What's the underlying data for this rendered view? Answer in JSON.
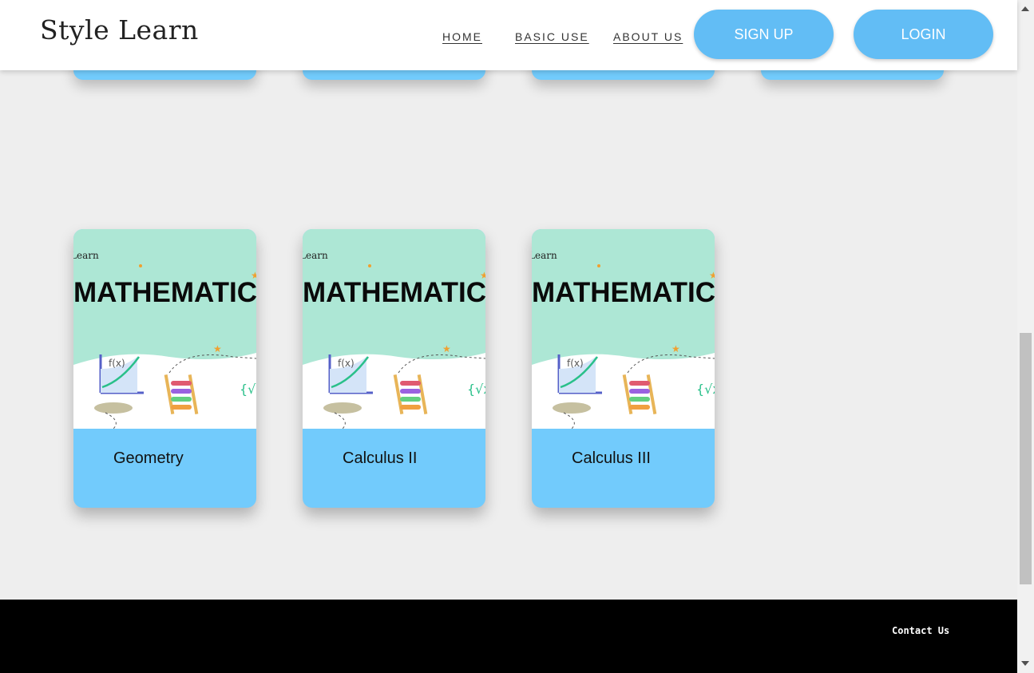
{
  "brand": {
    "logo_text": "Style Learn"
  },
  "nav": {
    "home": "HOME",
    "basic_use": "BASIC USE",
    "about_us": "ABOUT US"
  },
  "buttons": {
    "sign_up": "SIGN UP",
    "login": "LOGIN"
  },
  "cards": [
    {
      "label": "Geometry",
      "image_brand": "Learn",
      "image_title": "MATHEMATIC"
    },
    {
      "label": "Calculus II",
      "image_brand": "Learn",
      "image_title": "MATHEMATIC"
    },
    {
      "label": "Calculus III",
      "image_brand": "Learn",
      "image_title": "MATHEMATIC"
    }
  ],
  "footer": {
    "contact": "Contact Us"
  },
  "colors": {
    "accent": "#62bdf5",
    "card_footer": "#72cbfc",
    "card_image_bg": "#ade7d5",
    "page_bg": "#eeeeee"
  }
}
